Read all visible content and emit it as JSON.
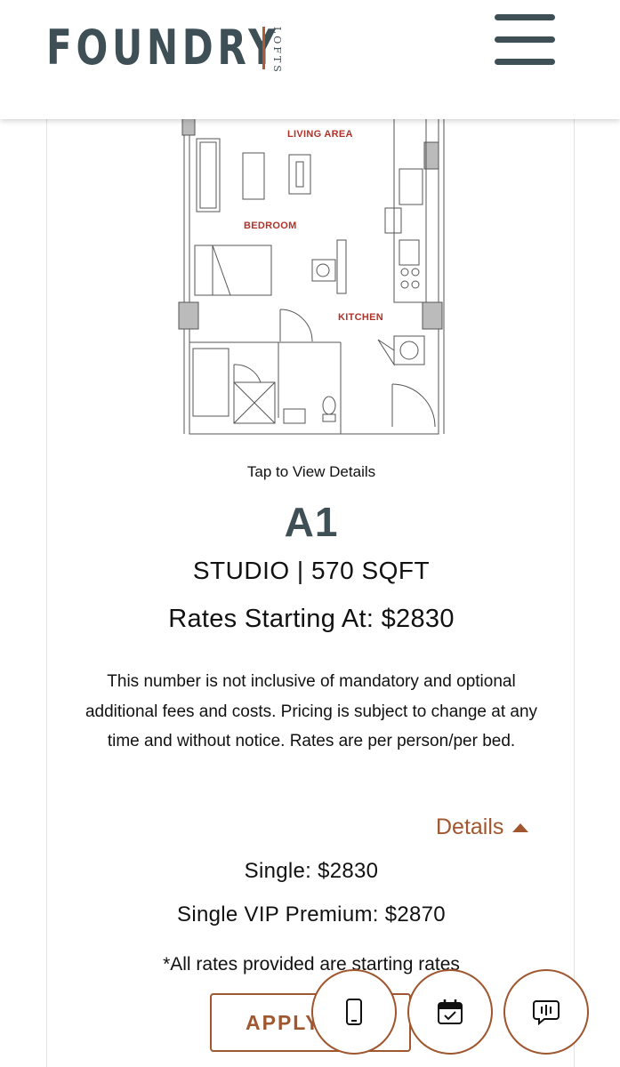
{
  "header": {
    "logo_main": "FOUNDRY",
    "logo_sub": "LOFTS",
    "menu_icon": "hamburger-menu-icon"
  },
  "floorplan": {
    "labels": {
      "living": "LIVING AREA",
      "bedroom": "BEDROOM",
      "kitchen": "KITCHEN"
    }
  },
  "unit": {
    "tap_text": "Tap to View Details",
    "name": "A1",
    "specs": "STUDIO | 570 SQFT",
    "rates_heading": "Rates Starting At: $2830",
    "disclaimer": "This number is not inclusive of mandatory and optional additional fees and costs. Pricing is subject to change at any time and without notice. Rates are per person/per bed.",
    "details_label": "Details",
    "prices": [
      {
        "text": "Single: $2830"
      },
      {
        "text": "Single VIP Premium: $2870"
      }
    ],
    "rates_note": "*All rates provided are starting rates",
    "apply_label": "APPLY"
  },
  "fabs": [
    {
      "icon": "phone-icon"
    },
    {
      "icon": "calendar-check-icon"
    },
    {
      "icon": "chat-icon"
    }
  ],
  "colors": {
    "brand_slate": "#3f4f56",
    "accent_rust": "#a0562e",
    "label_red": "#b0332a"
  }
}
